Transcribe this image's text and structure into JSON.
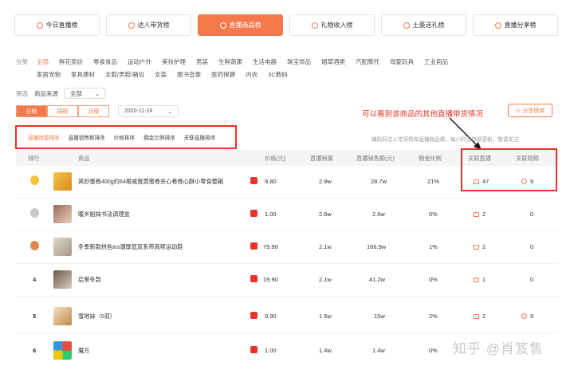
{
  "tabs": [
    {
      "label": "今日直播榜"
    },
    {
      "label": "达人带货榜"
    },
    {
      "label": "直播商品榜"
    },
    {
      "label": "礼物收入榜"
    },
    {
      "label": "土豪送礼榜"
    },
    {
      "label": "直播分享榜"
    }
  ],
  "category": {
    "label": "分类",
    "row1": [
      "全部",
      "鲜花家纺",
      "零食食品",
      "运动户外",
      "美妆护理",
      "男装",
      "生鲜蔬果",
      "生活电器",
      "珠宝饰品",
      "烟草酒类",
      "汽配摩托",
      "母婴玩具",
      "工业用品"
    ],
    "row2": [
      "家居宠物",
      "家具建材",
      "女鞋/男鞋/箱包",
      "女装",
      "图书音像",
      "医药保健",
      "内衣",
      "3C数码"
    ]
  },
  "filter": {
    "label": "筛选",
    "source_label": "商品来源",
    "source_value": "全部"
  },
  "periods": [
    "日榜",
    "周榜",
    "月榜"
  ],
  "date": "2020-11-24",
  "annotation": "可以看到该商品的其他直播带货情况",
  "share_button": "分享榜单",
  "sort_options": [
    "直播销量排序",
    "直播销售额排序",
    "价格排序",
    "佣金比例排序",
    "关联直播排序"
  ],
  "hint": "蝉妈妈达人带货榜和直播商品榜，每小时点持续更新，敬请关注",
  "table": {
    "headers": {
      "rank": "排行",
      "product": "商品",
      "price": "价格(元)",
      "sales": "直播销量",
      "revenue": "直播销售额(元)",
      "commission": "佣金比例",
      "related_live": "关联直播",
      "related_video": "关联视频"
    },
    "rows": [
      {
        "rank": "1",
        "name": "其妙蛋卷400g约64根咸蛋黄蛋卷夹心卷卷心酥小零食整箱",
        "price": "9.80",
        "sales": "2.9w",
        "revenue": "28.7w",
        "commission": "21%",
        "live": "47",
        "video": "9"
      },
      {
        "rank": "2",
        "name": "暖乡姐妹书法调理盒",
        "price": "1.00",
        "sales": "2.6w",
        "revenue": "2.6w",
        "commission": "0%",
        "live": "2",
        "video": "0"
      },
      {
        "rank": "3",
        "name": "冬季新款拼色ins潮厚底双系带高帮运动鞋",
        "price": "79.90",
        "sales": "2.1w",
        "revenue": "166.9w",
        "commission": "1%",
        "live": "2",
        "video": "0"
      },
      {
        "rank": "4",
        "name": "启茉冬款",
        "price": "19.90",
        "sales": "2.1w",
        "revenue": "41.2w",
        "commission": "0%",
        "live": "1",
        "video": "0"
      },
      {
        "rank": "5",
        "name": "雪地袜（5双）",
        "price": "9.90",
        "sales": "1.5w",
        "revenue": "15w",
        "commission": "2%",
        "live": "2",
        "video": "9"
      },
      {
        "rank": "6",
        "name": "魔方",
        "price": "1.00",
        "sales": "1.4w",
        "revenue": "1.4w",
        "commission": "0%",
        "live": "",
        "video": ""
      }
    ]
  },
  "watermark": "知乎 @肖笈售",
  "colors": {
    "accent": "#f47a4c",
    "annotation_red": "#e8332a"
  }
}
